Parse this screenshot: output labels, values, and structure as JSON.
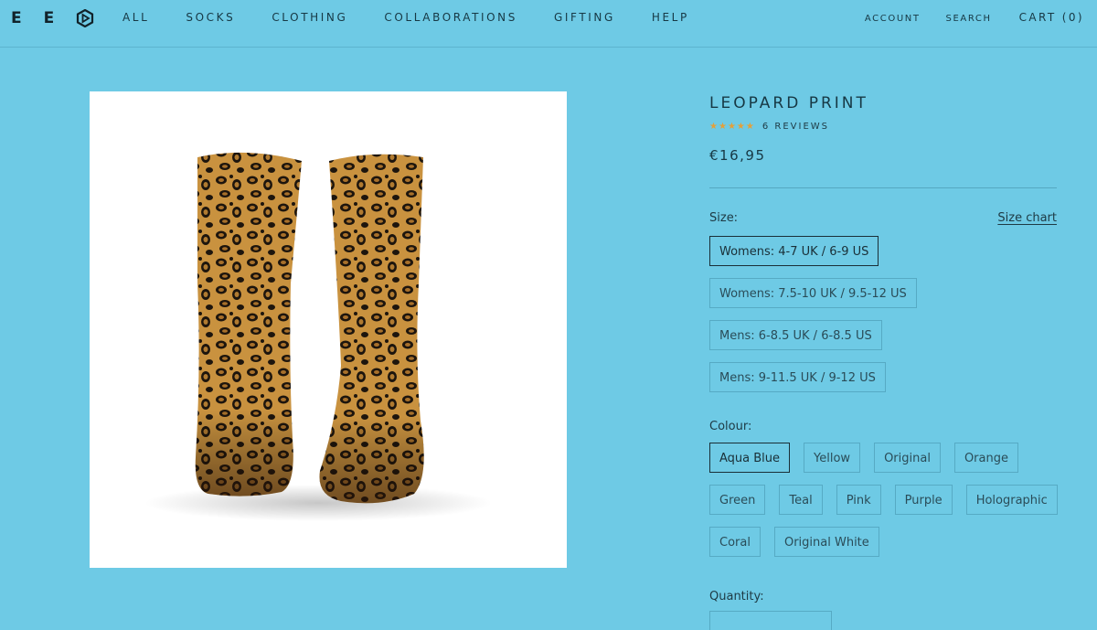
{
  "header": {
    "logo_letters": [
      "E",
      "E"
    ],
    "logo_icon": "hexagon-play-logo-icon",
    "nav": [
      "ALL",
      "SOCKS",
      "CLOTHING",
      "COLLABORATIONS",
      "GIFTING",
      "HELP"
    ],
    "account": "ACCOUNT",
    "search": "SEARCH",
    "cart": "CART (0)"
  },
  "product": {
    "image_alt": "Leopard print socks",
    "title": "LEOPARD PRINT",
    "rating": 5,
    "reviews": "6 REVIEWS",
    "price": "€16,95",
    "size_label": "Size:",
    "size_chart": "Size chart",
    "sizes": [
      "Womens: 4-7 UK / 6-9 US",
      "Womens: 7.5-10 UK / 9.5-12 US",
      "Mens: 6-8.5 UK / 6-8.5 US",
      "Mens: 9-11.5 UK / 9-12 US"
    ],
    "selected_size": "Womens: 4-7 UK / 6-9 US",
    "colour_label": "Colour:",
    "colours": [
      "Aqua Blue",
      "Yellow",
      "Original",
      "Orange",
      "Green",
      "Teal",
      "Pink",
      "Purple",
      "Holographic",
      "Coral",
      "Original White"
    ],
    "selected_colour": "Aqua Blue",
    "quantity_label": "Quantity:"
  },
  "colors": {
    "background": "#6ecae5",
    "star": "#e3a03a",
    "text": "#173844"
  }
}
